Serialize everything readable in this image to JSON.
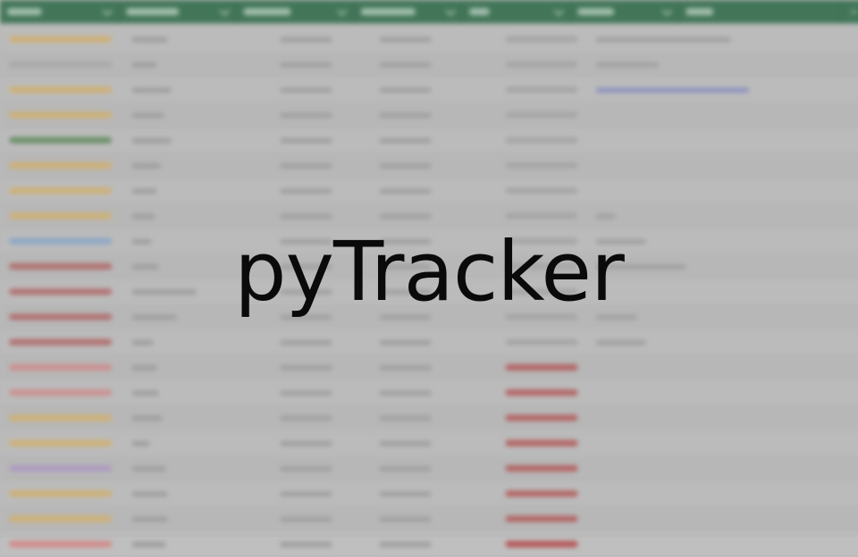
{
  "app": {
    "splash_title": "pyTracker"
  },
  "colors": {
    "header_bg": "#2c6b47",
    "status_yellow": "#d6b26a",
    "status_green": "#5e8a5a",
    "status_blue": "#86a7c9",
    "status_red": "#b36464",
    "status_pink": "#d38a8a",
    "status_purple": "#ad97c6",
    "timestamp_gray": "#a5a5a5",
    "timestamp_red": "#b55555",
    "note_gray": "#a0a0a0",
    "note_link": "#8b8fc4"
  },
  "header": {
    "columns": [
      {
        "icon": "chevron-down-icon"
      },
      {
        "icon": "chevron-down-icon"
      },
      {
        "icon": "chevron-down-icon"
      },
      {
        "icon": "chevron-down-icon"
      },
      {
        "icon": "chevron-down-icon"
      },
      {
        "icon": "chevron-down-icon"
      },
      {
        "icon": "chevron-down-icon"
      }
    ],
    "close_icon": "close-icon"
  },
  "rows": [
    {
      "status": "yellow",
      "ts": "gray",
      "note": "gray"
    },
    {
      "status": "gray",
      "ts": "gray",
      "note": "gray"
    },
    {
      "status": "yellow",
      "ts": "gray",
      "note": "link"
    },
    {
      "status": "yellow",
      "ts": "gray",
      "note": "none"
    },
    {
      "status": "green",
      "ts": "gray",
      "note": "none"
    },
    {
      "status": "yellow",
      "ts": "gray",
      "note": "none"
    },
    {
      "status": "yellow",
      "ts": "gray",
      "note": "none"
    },
    {
      "status": "yellow",
      "ts": "gray",
      "note": "gray"
    },
    {
      "status": "blue",
      "ts": "gray",
      "note": "gray"
    },
    {
      "status": "red",
      "ts": "gray",
      "note": "gray"
    },
    {
      "status": "red",
      "ts": "gray",
      "note": "none"
    },
    {
      "status": "red",
      "ts": "gray",
      "note": "gray"
    },
    {
      "status": "red",
      "ts": "gray",
      "note": "gray"
    },
    {
      "status": "pink",
      "ts": "red",
      "note": "none"
    },
    {
      "status": "pink",
      "ts": "red",
      "note": "none"
    },
    {
      "status": "yellow",
      "ts": "red",
      "note": "none"
    },
    {
      "status": "yellow",
      "ts": "red",
      "note": "none"
    },
    {
      "status": "purple",
      "ts": "red",
      "note": "none"
    },
    {
      "status": "yellow",
      "ts": "red",
      "note": "none"
    },
    {
      "status": "yellow",
      "ts": "red",
      "note": "none"
    },
    {
      "status": "pink",
      "ts": "red",
      "note": "none"
    }
  ]
}
